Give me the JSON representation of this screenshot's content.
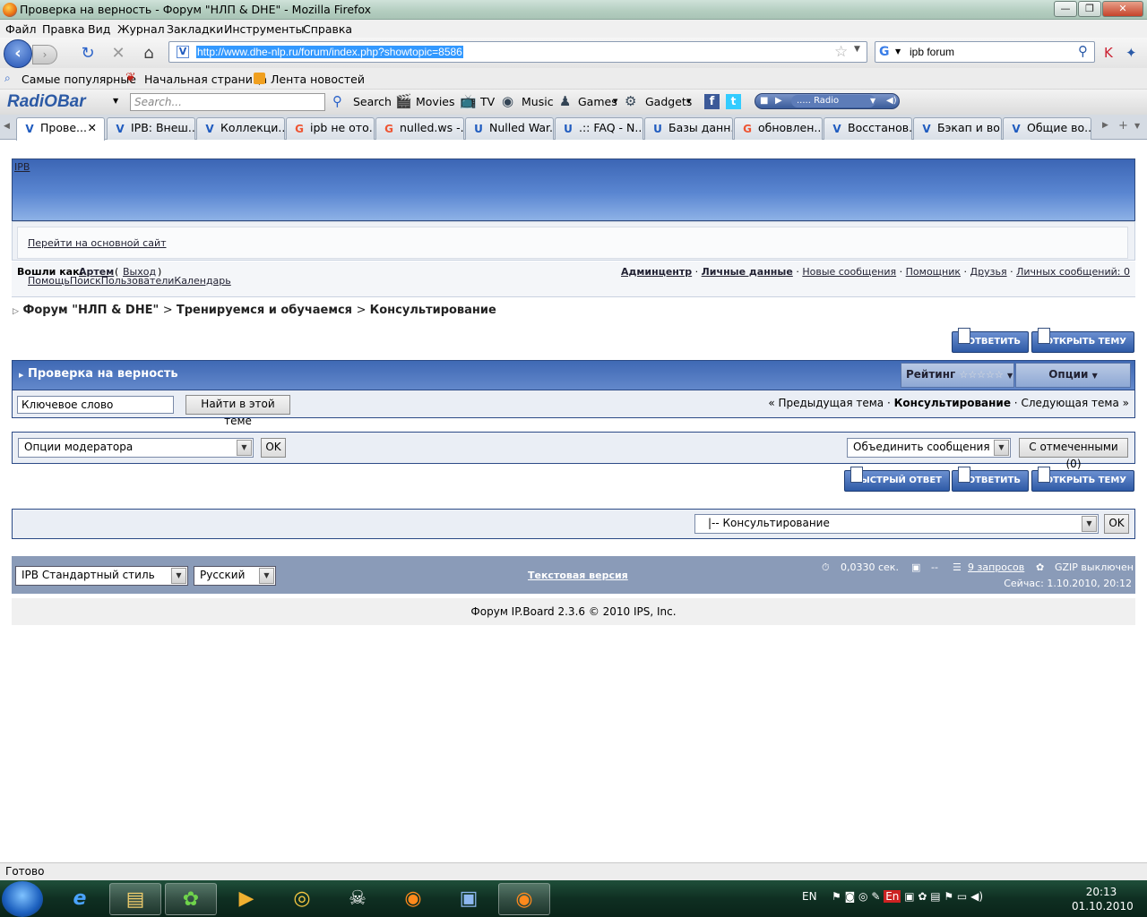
{
  "window": {
    "title": "Проверка на верность - Форум \"НЛП & DHE\" - Mozilla Firefox",
    "min": "—",
    "max": "❐",
    "close": "✕"
  },
  "menu": [
    "Файл",
    "Правка",
    "Вид",
    "Журнал",
    "Закладки",
    "Инструменты",
    "Справка"
  ],
  "nav": {
    "url": "http://www.dhe-nlp.ru/forum/index.php?showtopic=8586",
    "search_value": "ipb forum"
  },
  "bookmarks": [
    "Самые популярные",
    "Начальная страница",
    "Лента новостей"
  ],
  "radiobar": {
    "logo": "RadiOBar",
    "search_placeholder": "Search...",
    "search_btn": "Search",
    "movies": "Movies",
    "tv": "TV",
    "music": "Music",
    "games": "Games",
    "gadgets": "Gadgets",
    "radio": "..... Radio"
  },
  "tabs": [
    "Прове...",
    "IPB: Внеш...",
    "Коллекци...",
    "ipb не ото...",
    "nulled.ws -...",
    "Nulled War...",
    ".:: FAQ - N...",
    "Базы данн...",
    "обновлен...",
    "Восстанов...",
    "Бэкап и во...",
    "Общие во..."
  ],
  "forum": {
    "logo_text": "IPB",
    "main_site_link": "Перейти на основной сайт",
    "logged_as": "Вошли как:",
    "user": "Артем",
    "logout": "Выход",
    "links_right": [
      "Админцентр",
      "Личные данные",
      "Новые сообщения",
      "Помощник",
      "Друзья",
      "Личных сообщений: 0"
    ],
    "links_left": [
      "Помощь",
      "Поиск",
      "Пользователи",
      "Календарь"
    ],
    "breadcrumb": [
      "Форум \"НЛП & DHE\"",
      "Тренируемся и обучаемся",
      "Консультирование"
    ],
    "reply_btn": "ОТВЕТИТЬ",
    "new_topic_btn": "ОТКРЫТЬ ТЕМУ",
    "fast_reply_btn": "БЫСТРЫЙ ОТВЕТ",
    "topic_title": "Проверка на верность",
    "rating_label": "Рейтинг",
    "options_label": "Опции",
    "keyword_value": "Ключевое слово",
    "search_in_topic": "Найти в этой теме",
    "prev_topic": "« Предыдущая тема",
    "forum_name": "Консультирование",
    "next_topic": "Следующая тема »",
    "mod_options": "Опции модератора",
    "ok": "OK",
    "merge": "Объединить сообщения",
    "with_selected": "С отмеченными (0)",
    "jump_value": "|-- Консультирование",
    "style": "IPB Стандартный стиль",
    "lang": "Русский",
    "text_version": "Текстовая версия",
    "time": "0,0330 сек.",
    "dash": "--",
    "queries": "9 запросов",
    "gzip": "GZIP выключен",
    "now": "Сейчас: 1.10.2010, 20:12",
    "copyright": "Форум IP.Board 2.3.6 © 2010  IPS, Inc."
  },
  "status": "Готово",
  "taskbar": {
    "lang": "EN",
    "time": "20:13",
    "date": "01.10.2010"
  }
}
